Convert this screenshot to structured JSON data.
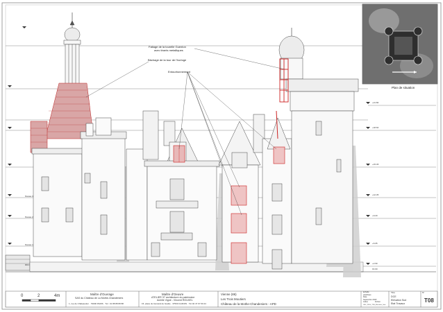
{
  "annotations": {
    "faitage": "Faitage de la tourelle Guenton",
    "faitage_sub": "avec tirants metalliques",
    "bachage": "Bâchage de la tour de l'horloge",
    "entourbonnement": "Entourbonnement"
  },
  "location_plan": {
    "label": "Plan de situation"
  },
  "scale_bar": {
    "labels": [
      "0",
      "2",
      "4m"
    ]
  },
  "level_labels_left": [
    "Niveau 3",
    "Niveau 2",
    "Niveau 1",
    "RDC"
  ],
  "level_labels_right": [
    "+21.80",
    "+18.60",
    "+15.45",
    "+12.35",
    "+9.20",
    "+6.05",
    "+2.90",
    "±0.00"
  ],
  "title_block": {
    "owner_title": "Maître d'Ouvrage",
    "owner_name": "SAS du Château de La Mothe-Chandeniers",
    "owner_address": "1, rue de Châteaudun · 79000 PARIS · Tél : 01 88 88 88 88",
    "architect_title": "Maître d'Oeuvre",
    "architect_name": "ATELIER 37 architecture du patrimoine",
    "architect_sub": "Achille Vigné - Vincent ROUXEL",
    "architect_address": "15, place du Général de Gaulle · 37500 CHINON · Tél 02 47 97 60 24",
    "dept": "Vienne (86)",
    "commune": "Les Trois Moutiers",
    "project": "Château de la Mothe-Chandeniers - APD",
    "meta_labels": [
      "Echelle",
      "graphique",
      "Date",
      "Septembre 2018",
      "Indice",
      "Fichier",
      "LMC_PH-H_TDE_Elevation_Sud"
    ],
    "view_title": "Titre",
    "view_lines": [
      "DCE",
      "Elévation Sud",
      "Etat Travaux"
    ],
    "sheet_label": "N°",
    "sheet_number": "T08"
  }
}
